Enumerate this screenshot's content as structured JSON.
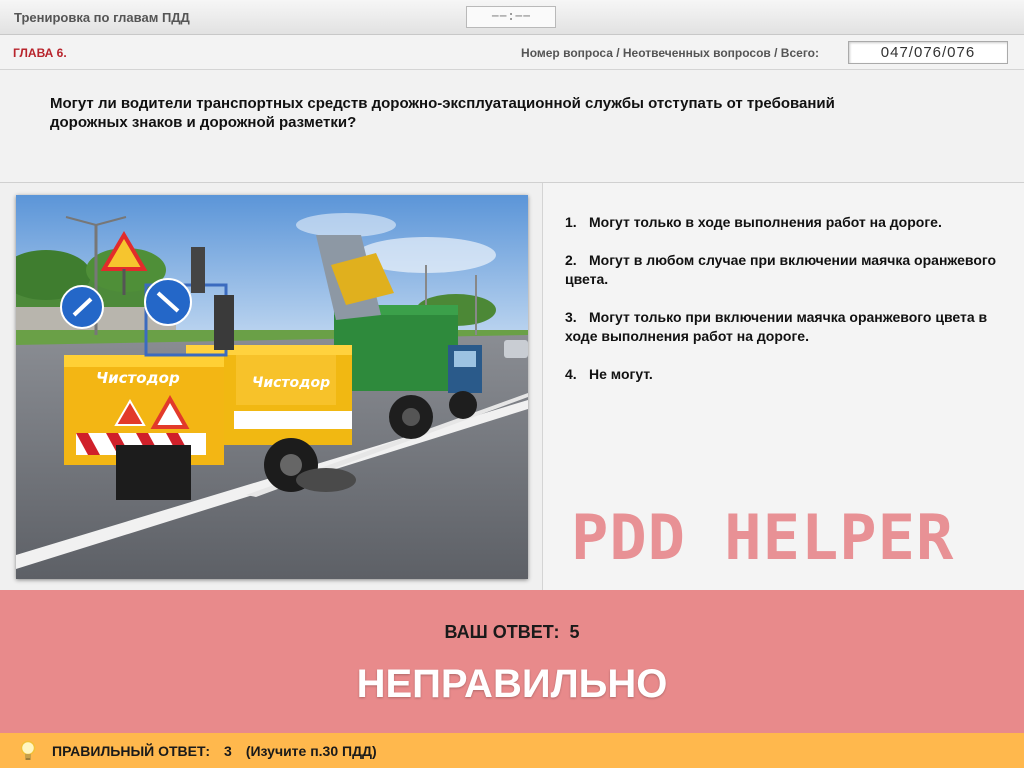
{
  "app": {
    "title": "Тренировка по главам ПДД",
    "timer": "−−:−−"
  },
  "chapter": {
    "label": "ГЛАВА 6.",
    "counter_label": "Номер вопроса / Неотвеченных вопросов / Всего:",
    "counter_value": "047/076/076"
  },
  "question": {
    "text": "Могут ли водители транспортных средств дорожно-эксплуатационной службы отступать от требований дорожных знаков и дорожной разметки?"
  },
  "answers": [
    {
      "num": "1.",
      "text": "Могут только в ходе выполнения работ на дороге."
    },
    {
      "num": "2.",
      "text": "Могут в любом случае при включении маячка оранжевого цвета."
    },
    {
      "num": "3.",
      "text": "Могут только при включении маячка оранжевого цвета в ходе выполнения работ на дороге."
    },
    {
      "num": "4.",
      "text": "Не могут."
    }
  ],
  "watermark": "PDD HELPER",
  "photo": {
    "vehicle_brand": "Чистодор"
  },
  "result": {
    "your_answer_label": "ВАШ ОТВЕТ:",
    "your_answer_value": "5",
    "verdict": "НЕПРАВИЛЬНО"
  },
  "hint": {
    "label": "ПРАВИЛЬНЫЙ ОТВЕТ:",
    "value": "3",
    "note": "(Изучите п.30 ПДД)"
  },
  "colors": {
    "chapter_red": "#b8242c",
    "result_bg": "#e88a8b",
    "hint_bg": "#ffb84d",
    "watermark": "#e7898d"
  },
  "icons": {
    "hint": "lightbulb-icon"
  }
}
